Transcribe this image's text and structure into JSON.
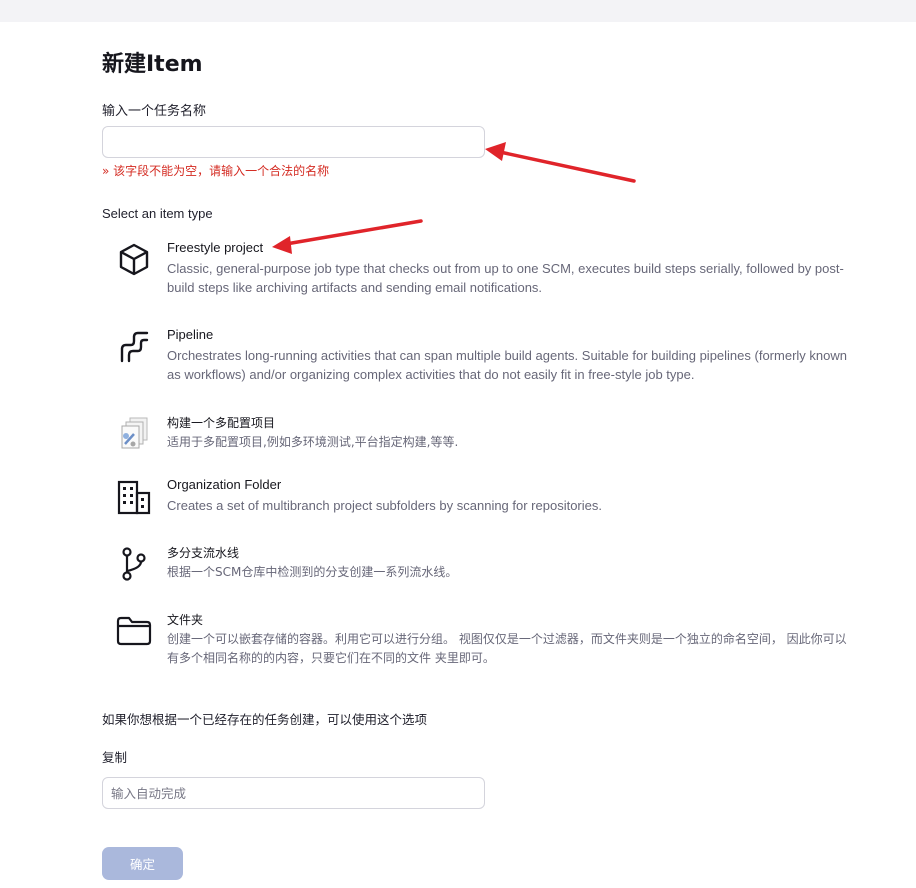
{
  "page": {
    "title": "新建Item"
  },
  "name_field": {
    "label": "输入一个任务名称",
    "value": "",
    "error": "» 该字段不能为空，请输入一个合法的名称"
  },
  "item_type_section": {
    "label": "Select an item type"
  },
  "item_types": [
    {
      "icon": "cube-icon",
      "name": "Freestyle project",
      "description": "Classic, general-purpose job type that checks out from up to one SCM, executes build steps serially, followed by post-build steps like archiving artifacts and sending email notifications."
    },
    {
      "icon": "pipeline-icon",
      "name": "Pipeline",
      "description": "Orchestrates long-running activities that can span multiple build agents. Suitable for building pipelines (formerly known as workflows) and/or organizing complex activities that do not easily fit in free-style job type."
    },
    {
      "icon": "multi-configuration-icon",
      "name": "构建一个多配置项目",
      "description": "适用于多配置项目,例如多环境测试,平台指定构建,等等."
    },
    {
      "icon": "organization-folder-icon",
      "name": "Organization Folder",
      "description": "Creates a set of multibranch project subfolders by scanning for repositories."
    },
    {
      "icon": "branch-icon",
      "name": "多分支流水线",
      "description": "根据一个SCM仓库中检测到的分支创建一系列流水线。"
    },
    {
      "icon": "folder-icon",
      "name": "文件夹",
      "description": "创建一个可以嵌套存储的容器。利用它可以进行分组。 视图仅仅是一个过滤器，而文件夹则是一个独立的命名空间， 因此你可以有多个相同名称的的内容，只要它们在不同的文件 夹里即可。"
    }
  ],
  "copy_section": {
    "hint": "如果你想根据一个已经存在的任务创建，可以使用这个选项",
    "label": "复制",
    "placeholder": "输入自动完成",
    "value": ""
  },
  "ok_button": {
    "label": "确定"
  },
  "colors": {
    "error": "#d42b22",
    "button_disabled": "#aab8dc",
    "annotation_arrow": "#e0242a",
    "description_text": "#676778"
  }
}
